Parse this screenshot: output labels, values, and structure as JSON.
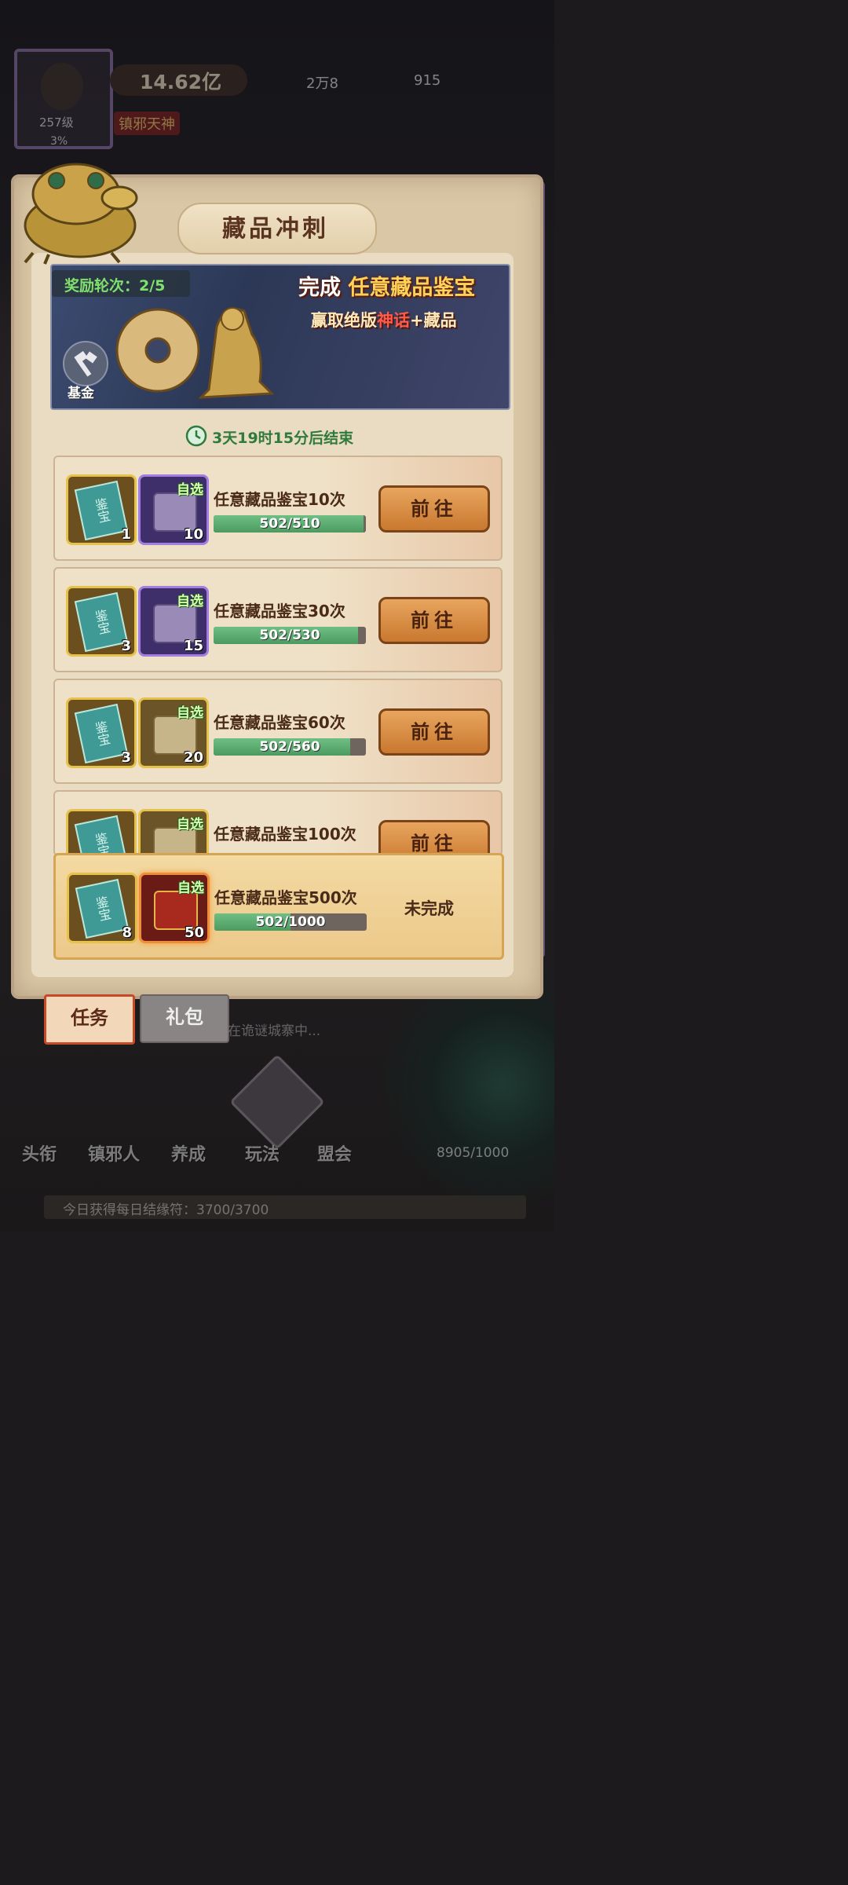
{
  "top_bar": {
    "level": "257级",
    "exp": "3%",
    "power": "14.62亿",
    "resource_1": "2万8",
    "resource_2": "915",
    "title_badge": "镇邪天神"
  },
  "panel": {
    "title": "藏品冲刺",
    "round_label": "奖励轮次：2/5",
    "banner_line1_prefix": "完成",
    "banner_line1_highlight": "任意藏品鉴宝",
    "banner_line2_prefix": "赢取绝版",
    "banner_line2_red": "神话",
    "banner_line2_suffix": "+藏品",
    "fund_label": "基金",
    "timer": "3天19时15分后结束"
  },
  "tasks": [
    {
      "title": "任意藏品鉴宝10次",
      "progress_text": "502/510",
      "progress": 0.984,
      "ticket_qty": "1",
      "chest_qty": "10",
      "chest_tag": "自选",
      "action": "前往",
      "chest_type": "purple"
    },
    {
      "title": "任意藏品鉴宝30次",
      "progress_text": "502/530",
      "progress": 0.947,
      "ticket_qty": "3",
      "chest_qty": "15",
      "chest_tag": "自选",
      "action": "前往",
      "chest_type": "purple"
    },
    {
      "title": "任意藏品鉴宝60次",
      "progress_text": "502/560",
      "progress": 0.896,
      "ticket_qty": "3",
      "chest_qty": "20",
      "chest_tag": "自选",
      "action": "前往",
      "chest_type": "gold"
    },
    {
      "title": "任意藏品鉴宝100次",
      "action": "前往",
      "chest_tag": "自选",
      "chest_type": "gold"
    },
    {
      "title": "任意藏品鉴宝500次",
      "progress_text": "502/1000",
      "progress": 0.502,
      "ticket_qty": "8",
      "chest_qty": "50",
      "chest_tag": "自选",
      "status": "未完成",
      "chest_type": "red"
    }
  ],
  "ticket_text": "鉴宝",
  "tabs": {
    "task": "任务",
    "gift": "礼包"
  },
  "bottom": {
    "news": "在诡谜城寨中...",
    "nav": [
      "头衔",
      "镇邪人",
      "养成",
      "玩法",
      "盟会"
    ],
    "counter": "8905/1000",
    "daily": "今日获得每日结缘符：3700/3700"
  },
  "colors": {
    "progress_green": "#4c9a60",
    "go_button": "#d08a40",
    "highlight_gold": "#ffd257"
  }
}
